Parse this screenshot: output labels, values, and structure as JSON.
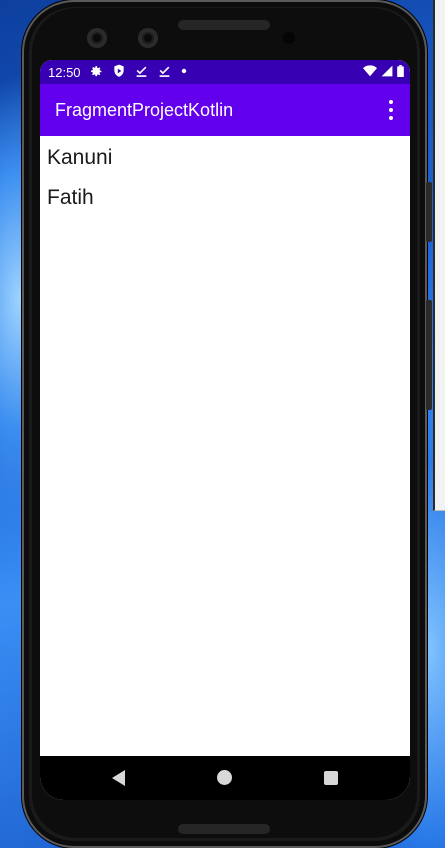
{
  "status_bar": {
    "time": "12:50",
    "left_icons": [
      "gear-icon",
      "shield-icon",
      "download-done-icon",
      "download-done-icon",
      "dot-icon"
    ],
    "right_icons": [
      "wifi-icon",
      "cell-signal-icon",
      "battery-icon"
    ],
    "background": "#3700b3"
  },
  "app_bar": {
    "title": "FragmentProjectKotlin",
    "background": "#6200ee",
    "menu_icon": "more-vert-icon"
  },
  "list": {
    "items": [
      {
        "label": "Kanuni"
      },
      {
        "label": "Fatih"
      }
    ]
  },
  "nav_bar": {
    "buttons": [
      "back-icon",
      "home-icon",
      "recents-icon"
    ]
  }
}
